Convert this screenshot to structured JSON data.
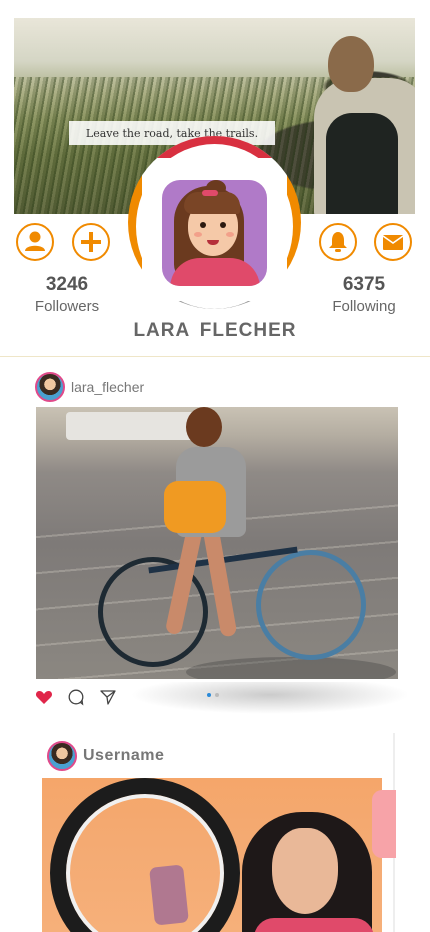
{
  "cover": {
    "quote": "Leave the road, take the trails."
  },
  "profile": {
    "name": "LARA  FLECHER",
    "followers": {
      "count": "3246",
      "label": "Followers"
    },
    "following": {
      "count": "6375",
      "label": "Following"
    }
  },
  "actions": {
    "left": [
      "profile-icon",
      "add-icon"
    ],
    "right": [
      "notification-bell-icon",
      "mail-icon"
    ]
  },
  "posts": [
    {
      "username": "lara_flecher",
      "carousel_dots": 2,
      "active_dot": 0
    },
    {
      "username": "Username"
    }
  ],
  "colors": {
    "accent": "#f08a00",
    "like": "#e0264a",
    "divider": "#efe6c8"
  }
}
